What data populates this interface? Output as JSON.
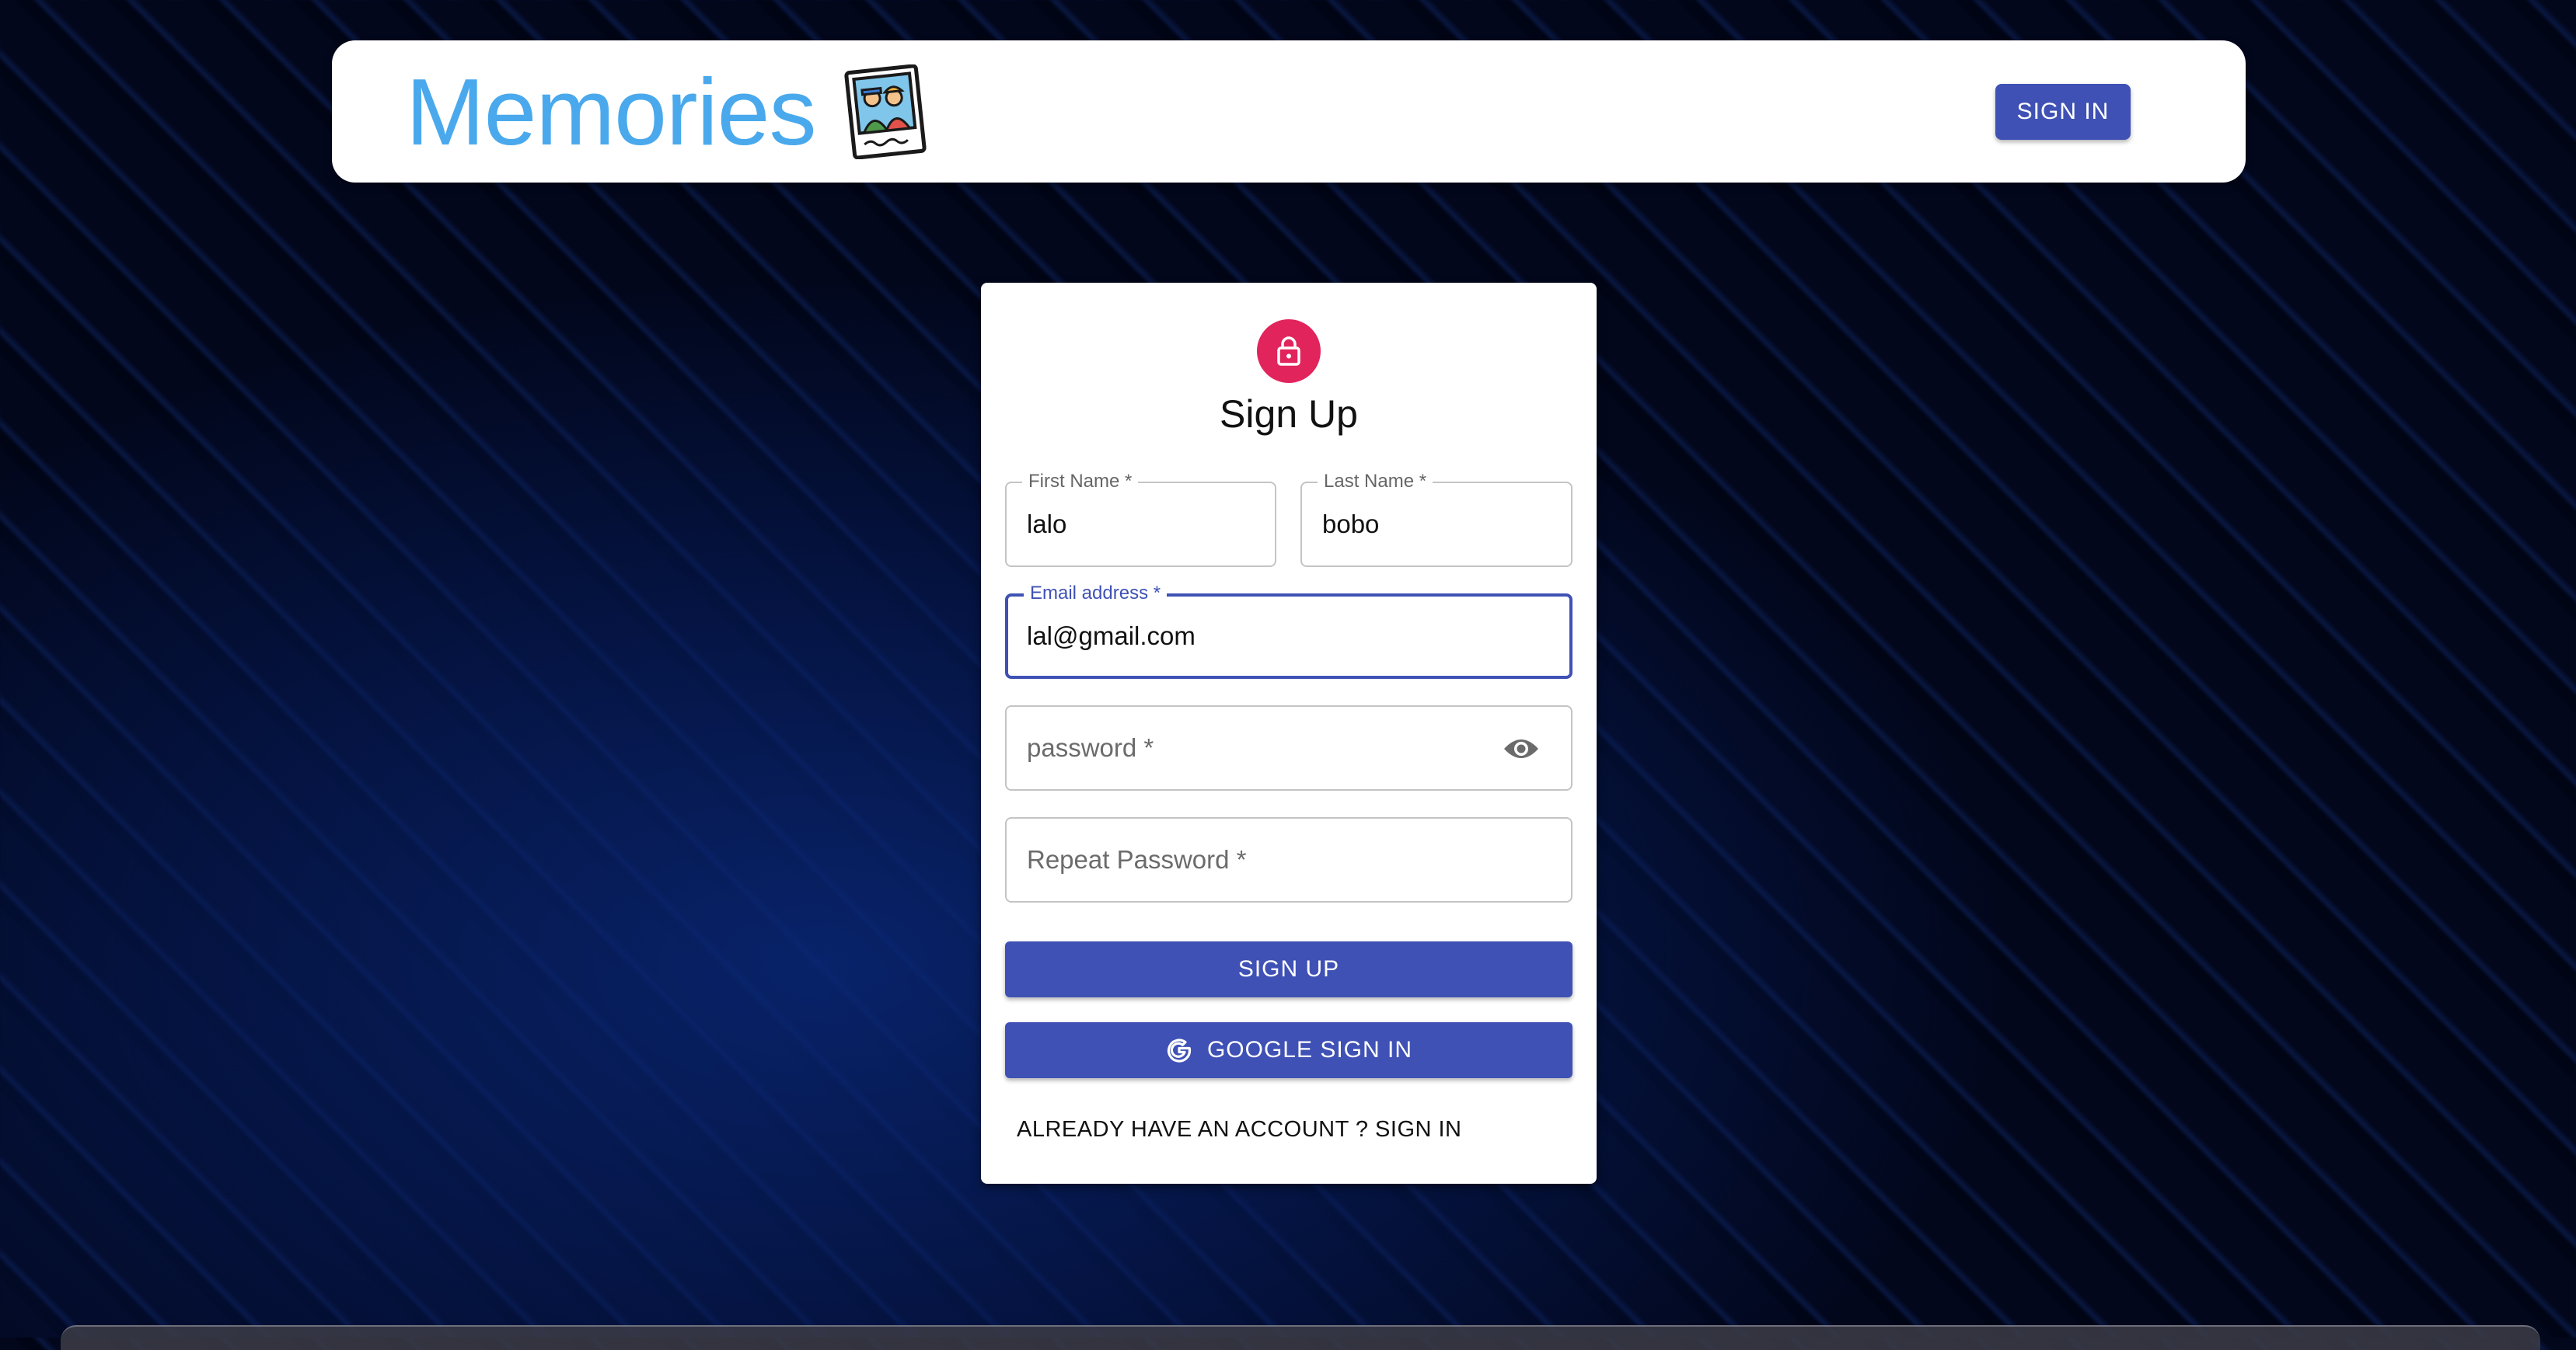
{
  "header": {
    "brand_title": "Memories",
    "brand_icon": "polaroid-photo-icon",
    "signin_label": "SIGN IN"
  },
  "form": {
    "title": "Sign Up",
    "avatar_icon": "lock-icon",
    "first_name": {
      "label": "First Name *",
      "value": "lalo"
    },
    "last_name": {
      "label": "Last Name *",
      "value": "bobo"
    },
    "email": {
      "label": "Email address *",
      "value": "lal@gmail.com"
    },
    "password": {
      "placeholder": "password *"
    },
    "repeat_password": {
      "placeholder": "Repeat Password *"
    },
    "signup_label": "SIGN UP",
    "google_label": "GOOGLE SIGN IN",
    "switch_label": "ALREADY HAVE AN ACCOUNT ? SIGN IN"
  },
  "colors": {
    "brand": "#4aa9ec",
    "primary": "#3f51b5",
    "avatar": "#e2245c"
  }
}
